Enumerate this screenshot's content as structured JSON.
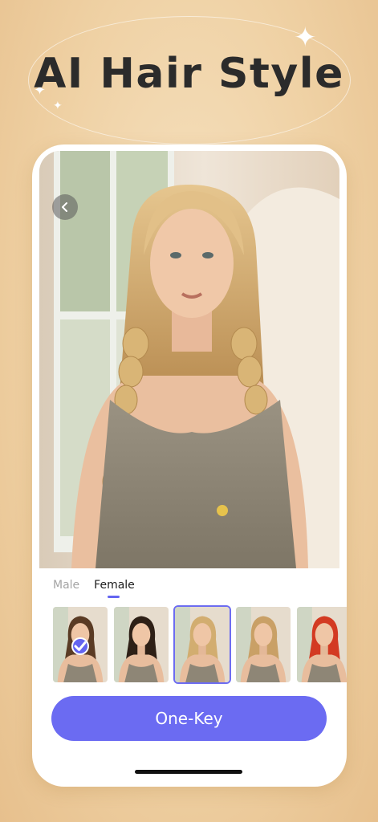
{
  "header": {
    "title": "AI Hair Style"
  },
  "tabs": [
    {
      "label": "Male",
      "active": false
    },
    {
      "label": "Female",
      "active": true
    }
  ],
  "styles": [
    {
      "hair": "#5a3b24",
      "checked": true,
      "selected": false
    },
    {
      "hair": "#2e2016",
      "checked": false,
      "selected": false
    },
    {
      "hair": "#d2ad70",
      "checked": false,
      "selected": true
    },
    {
      "hair": "#c9a066",
      "checked": false,
      "selected": false
    },
    {
      "hair": "#d33a22",
      "checked": false,
      "selected": false
    }
  ],
  "cta": {
    "label": "One-Key"
  },
  "colors": {
    "accent": "#6b6bf2",
    "title": "#2b2b2b",
    "background": "#efd1a4"
  },
  "icons": {
    "back": "chevron-left-icon",
    "check": "check-icon",
    "sparkle": "sparkle-icon"
  }
}
